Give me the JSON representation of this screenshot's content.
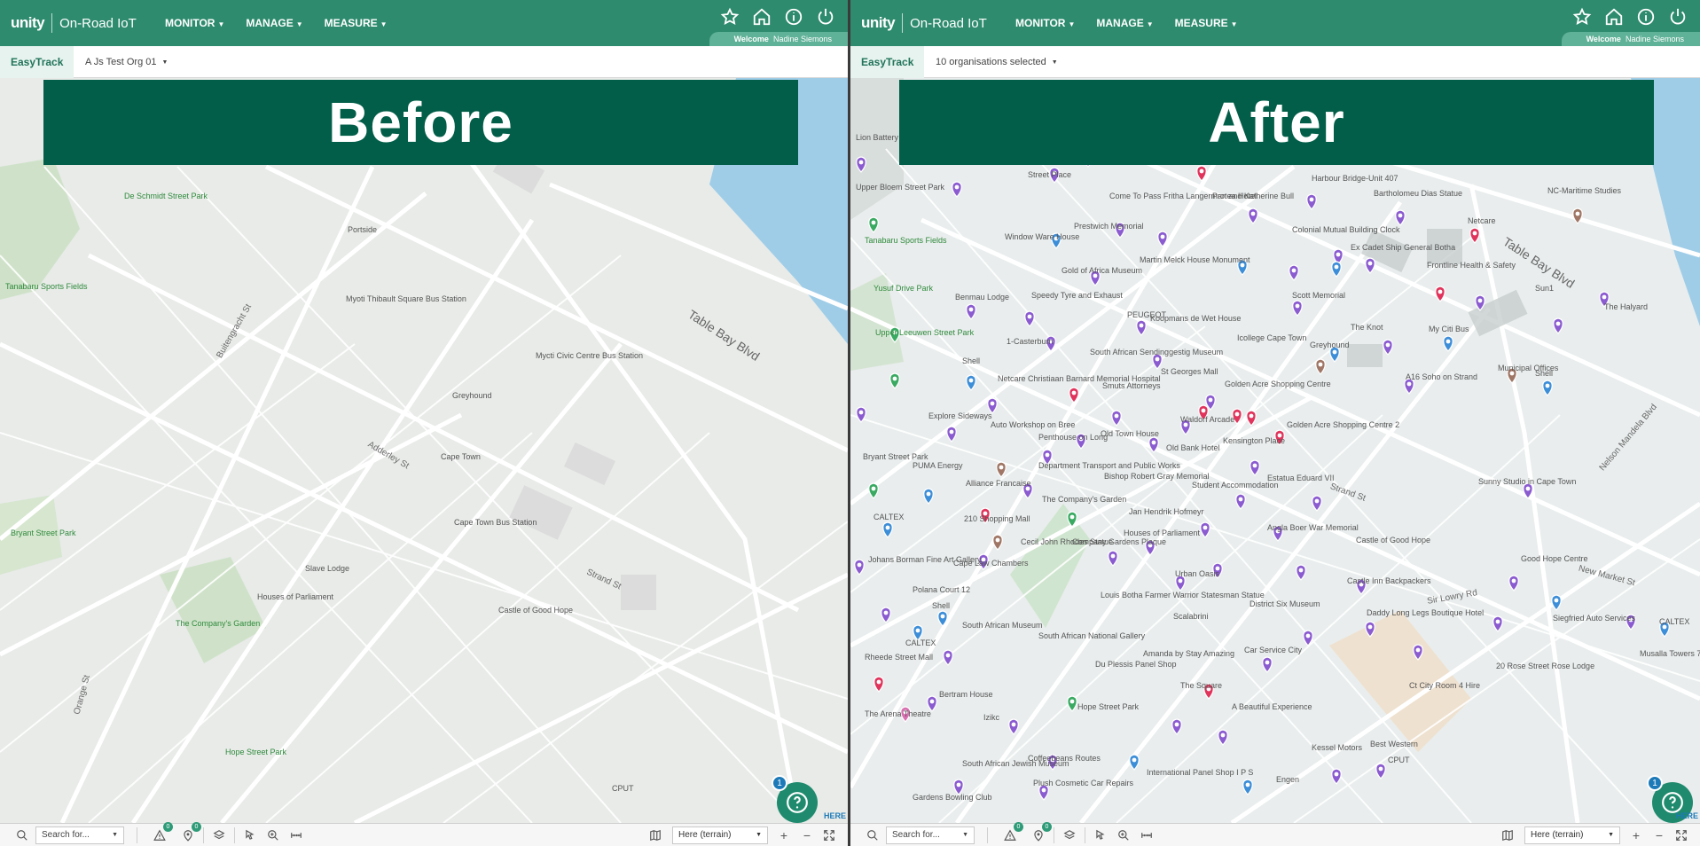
{
  "screens": [
    {
      "id": "left",
      "brand": "unity",
      "app_name": "On-Road IoT",
      "nav": [
        "MONITOR",
        "MANAGE",
        "MEASURE"
      ],
      "welcome_label": "Welcome",
      "user_name": "Nadine Siemons",
      "tab": "EasyTrack",
      "org_select": "A Js Test Org 01",
      "banner": "Before",
      "help_badge": "1",
      "here_text": "HERE",
      "search_placeholder": "Search for...",
      "alert_count": "0",
      "poi_count": "0",
      "map_layer": "Here (terrain)",
      "labels": [
        "De Schmidt Street Park",
        "Tanabaru Sports Fields",
        "Portside",
        "Myoti Thibault Square Bus Station",
        "Greyhound",
        "Cape Town",
        "Cape Town Bus Station",
        "Mycti Civic Centre Bus Station",
        "Table Bay Blvd",
        "Strand St",
        "Buitengracht St",
        "Bryant Street Park",
        "The Company's Garden",
        "Houses of Parliament",
        "Slave Lodge",
        "Castle of Good Hope",
        "Hope Street Park",
        "Orange St",
        "CPUT",
        "Adderley St"
      ]
    },
    {
      "id": "right",
      "brand": "unity",
      "app_name": "On-Road IoT",
      "nav": [
        "MONITOR",
        "MANAGE",
        "MEASURE"
      ],
      "welcome_label": "Welcome",
      "user_name": "Nadine Siemons",
      "tab": "EasyTrack",
      "org_select": "10 organisations selected",
      "banner": "After",
      "help_badge": "1",
      "here_text": "HERE",
      "search_placeholder": "Search for...",
      "alert_count": "0",
      "poi_count": "0",
      "map_layer": "Here (terrain)",
      "labels": [
        "Harbour Bridge-Unit 407",
        "Bartholomeu Dias Statue",
        "NC-Maritime Studies",
        "Netcare",
        "Table Bay Blvd",
        "Colonial Mutual Building Clock",
        "Ex Cadet Ship General Botha",
        "Frontline Health & Safety",
        "Sun1",
        "The Halyard",
        "The Knot",
        "My Citi Bus",
        "Municipal Offices",
        "Shell",
        "A16 Soho on Strand",
        "Golden Acre Shopping Centre 2",
        "Kensington Place",
        "Estatua Eduard VII",
        "Angla Boer War Memorial",
        "Castle of Good Hope",
        "Castle Inn Backpackers",
        "Daddy Long Legs Boutique Hotel",
        "Sunny Studio in Cape Town",
        "Good Hope Centre",
        "Siegfried Auto Services",
        "Musalla Towers 79",
        "CALTEX",
        "20 Rose Street Rose Lodge",
        "Ct City Room 4 Hire",
        "CPUT",
        "Best Western",
        "Kessel Motors",
        "Engen",
        "International Panel Shop I P S",
        "The Square",
        "A Beautiful Experience",
        "Car Service City",
        "District Six Museum",
        "Scalabrini",
        "Amanda by Stay Amazing",
        "Du Plessis Panel Shop",
        "Hope Street Park",
        "South African National Gallery",
        "Coffeebeans Routes",
        "Plush Cosmetic Car Repairs",
        "South African Jewish Museum",
        "Gardens Bowling Club",
        "Bertram House",
        "Izikc",
        "South African Museum",
        "Rheede Street Mall",
        "The Arena Theatre",
        "CALTEX",
        "Polana Court 12",
        "Shell",
        "Johans Borman Fine Art Gallery",
        "Cape Law Chambers",
        "210 Shopping Mall",
        "Cecil John Rhodes Statue",
        "Company Gardens Plaque",
        "Louis Botha Farmer Warrior Statesman Statue",
        "Houses of Parliament",
        "Urban Oasis",
        "Jan Hendrik Hofmeyr",
        "Student Accommodation",
        "Bishop Robert Gray Memorial",
        "The Company's Garden",
        "Department Transport and Public Works",
        "Alliance Francaise",
        "PUMA Energy",
        "CALTEX",
        "Bryant Street Park",
        "Explore Sideways",
        "Auto Workshop on Bree",
        "Penthouse on Long",
        "Old Town House",
        "Old Bank Hotel",
        "Waldorf Arcade",
        "Netcare Christiaan Barnard Memorial Hospital",
        "Smuts Attorneys",
        "St Georges Mall",
        "Golden Acre Shopping Centre",
        "South African Sendinggestig Museum",
        "1-Casterburn",
        "Speedy Tyre and Exhaust",
        "Benmau Lodge",
        "Koopmans de Wet House",
        "PEUGEOT",
        "Gold of Africa Museum",
        "Martin Melck House Monument",
        "Prestwich Memorial",
        "Window Ware House",
        "Come To Pass Fritha Langerman and Katherine Bull",
        "Protea Hotel",
        "Street Place",
        "Lion Battery",
        "Upper Bloem Street Park",
        "Tanabaru Sports Fields",
        "Yusuf Drive Park",
        "Upper Leeuwen Street Park",
        "Shell",
        "Scott Memorial",
        "Icollege Cape Town",
        "Greyhound",
        "Strand St",
        "New Market St",
        "Sir Lowry Rd",
        "Nelson Mandela Blvd"
      ]
    }
  ],
  "icons": {
    "favorite": "star-icon",
    "home": "home-icon",
    "info": "info-icon",
    "power": "power-icon",
    "search": "search-icon",
    "alerts": "warning-icon",
    "poi": "location-pin-icon",
    "layers": "layers-icon",
    "select": "cursor-icon",
    "zoom": "zoom-icon",
    "measure": "ruler-icon",
    "map": "map-icon",
    "zoom_in": "plus-icon",
    "zoom_out": "minus-icon",
    "fullscreen": "fullscreen-icon",
    "help": "help-icon"
  },
  "colors": {
    "header": "#2e8b6e",
    "banner": "#025e48",
    "pin_purple": "#8b5bd0",
    "pin_red": "#e0345c",
    "pin_blue": "#3d8ed8",
    "pin_brown": "#a07766",
    "pin_green": "#3aaa62",
    "water": "#9fcde8"
  }
}
